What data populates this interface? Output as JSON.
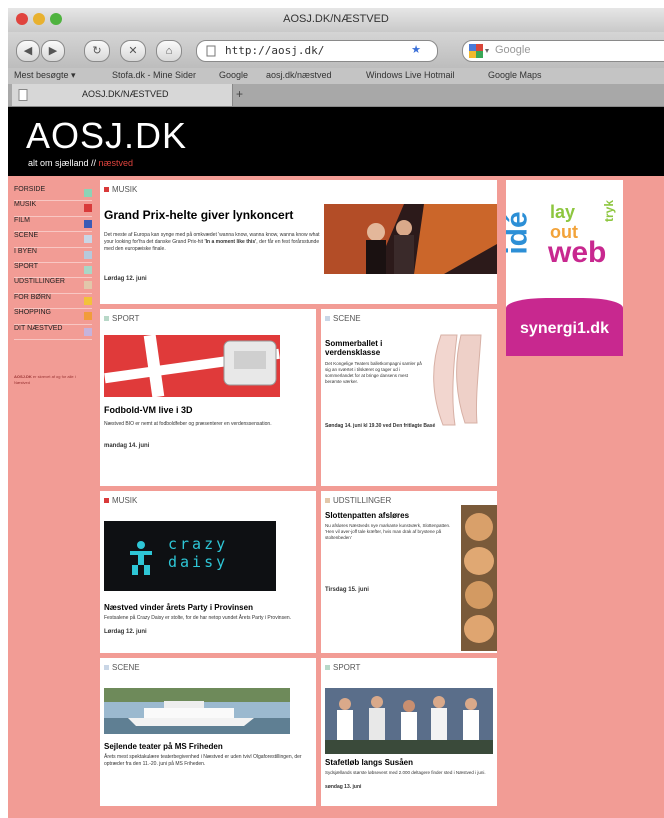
{
  "window": {
    "title": "AOSJ.DK/NÆSTVED"
  },
  "navbar": {
    "url": "http://aosj.dk/",
    "search_placeholder": "Google",
    "back_glyph": "◀",
    "forward_glyph": "▶",
    "reload_glyph": "↻",
    "stop_glyph": "✕",
    "home_glyph": "⌂",
    "star_glyph": "★"
  },
  "bookmarks": [
    "Mest besøgte ▾",
    "Stofa.dk - Mine Sider",
    "Google",
    "aosj.dk/næstved",
    "Windows Live Hotmail",
    "Google Maps"
  ],
  "tabs": [
    {
      "label": "AOSJ.DK/NÆSTVED"
    }
  ],
  "new_tab": "+",
  "site": {
    "logo": "AOSJ.DK",
    "tagline_main": "alt om sjælland // ",
    "tagline_accent": "næstved"
  },
  "sidebar": {
    "items": [
      {
        "label": "FORSIDE",
        "color": "#8dd3b6"
      },
      {
        "label": "MUSIK",
        "color": "#d93a3a"
      },
      {
        "label": "FILM",
        "color": "#3a5bb6"
      },
      {
        "label": "SCENE",
        "color": "#c9d6e6"
      },
      {
        "label": "I BYEN",
        "color": "#b7c9dc"
      },
      {
        "label": "SPORT",
        "color": "#a9d7c6"
      },
      {
        "label": "UDSTILLINGER",
        "color": "#e2c7aa"
      },
      {
        "label": "FOR BØRN",
        "color": "#f2c23a"
      },
      {
        "label": "SHOPPING",
        "color": "#f29c3a"
      },
      {
        "label": "DIT NÆSTVED",
        "color": "#c6b3dc"
      }
    ],
    "about_title": "AOSJ.DK",
    "about_text": "er skrevet af og for alle i Næstved"
  },
  "cards": {
    "c1": {
      "category": "MUSIK",
      "cat_color": "#d93a3a",
      "title": "Grand Prix-helte giver lynkoncert",
      "body": "Det meste af Europa kan synge med på omkvædet 'wanna know, wanna know, wanna know what your looking for'fra det danske Grand Prix-hit",
      "quote": "'In a moment like this'",
      "quote_rest": ", der får en fest forårsstunde med den europæiske finale.",
      "date": "Lørdag 12. juni"
    },
    "c2": {
      "category": "SPORT",
      "cat_color": "#b8d8c8",
      "title": "Fodbold-VM live i 3D",
      "body": "Næstved BIO er nemt at fodboldfeber og præsenterer en verdenssensation.",
      "date": "mandag 14. juni"
    },
    "c3": {
      "category": "SCENE",
      "cat_color": "#c9d6e6",
      "title": "Sommerballet i verdensklasse",
      "body": "Det Kongelige Teaters balletkompagni samler på sig an sværtet i tilskæret og tager ud i sommerlandet for at bringe dansens mest berømte værker.",
      "date": "Søndag 14. juni kl 19.30 ved Den fritlagte Basé"
    },
    "c4": {
      "category": "MUSIK",
      "cat_color": "#d93a3a",
      "title": "Næstved vinder årets Party i Provinsen",
      "body": "Festsalene på Crazy Daisy er stolte, for de har netop vundet Årets Party i Provinsen.",
      "date": "Lørdag 12. juni",
      "logo_text_1": "crazy",
      "logo_text_2": "daisy"
    },
    "c5": {
      "category": "UDSTILLINGER",
      "cat_color": "#e2c7aa",
      "title": "Slottenpatten afsløres",
      "body": "Nu afsløres Næstveds nye markante kunstværk, Slottenpatten. 'Hen vil aver-joff tale kræfter, hvis man drak af brystene på stoltenbeden'",
      "date": "Tirsdag 15. juni"
    },
    "c6": {
      "category": "SCENE",
      "cat_color": "#c9d6e6",
      "title": "Sejlende teater på MS Friheden",
      "body": "Årets mest spektakulære teaterbegivenhed i Næstved er uden tvivl Olgaforestillingen, der optræder fra den 11.-20. juni på MS Friheden.",
      "date": ""
    },
    "c7": {
      "category": "SPORT",
      "cat_color": "#b8d8c8",
      "title": "Stafetløb langs Susåen",
      "body": "Sydsjællands største løbsevent med 2.000 deltagere finder sted i Næstved i juni.",
      "date": "søndag 13. juni"
    }
  },
  "ad": {
    "brand": "synergi1.dk",
    "word_ide": "idé",
    "word_lay": "lay",
    "word_out": "out",
    "word_web": "web",
    "word_tryk": "tryk"
  }
}
